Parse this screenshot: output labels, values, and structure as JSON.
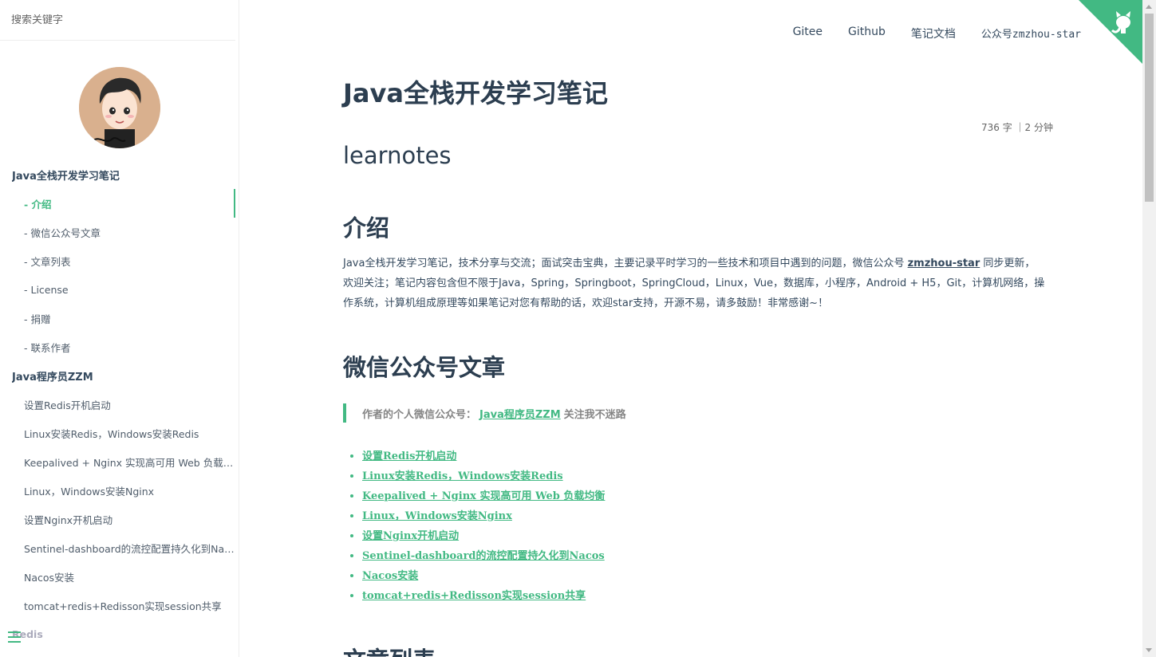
{
  "search": {
    "placeholder": "搜索关键字"
  },
  "sidebar": {
    "sections": [
      {
        "label": "Java全栈开发学习笔记"
      },
      {
        "label": "Java程序员ZZM"
      },
      {
        "label": "Redis"
      }
    ],
    "subitems": [
      "- 介绍",
      "- 微信公众号文章",
      "- 文章列表",
      "- License",
      "- 捐赠",
      "- 联系作者"
    ],
    "articles": [
      "设置Redis开机启动",
      "Linux安装Redis，Windows安装Redis",
      "Keepalived + Nginx 实现高可用 Web 负载均衡",
      "Linux，Windows安装Nginx",
      "设置Nginx开机启动",
      "Sentinel-dashboard的流控配置持久化到Nacos",
      "Nacos安装",
      "tomcat+redis+Redisson实现session共享"
    ]
  },
  "topnav": {
    "gitee": "Gitee",
    "github": "Github",
    "docs": "笔记文档",
    "wechat": "公众号zmzhou-star"
  },
  "content": {
    "title": "Java全栈开发学习笔记",
    "wordcount": "736 字 ｜2 分钟",
    "subtitle": "learnotes",
    "intro_heading": "介绍",
    "intro_text_1": "Java全栈开发学习笔记，技术分享与交流；面试突击宝典，主要记录平时学习的一些技术和项目中遇到的问题，微信公众号 ",
    "intro_link": "zmzhou-star",
    "intro_text_2": " 同步更新，欢迎关注；笔记内容包含但不限于Java，Spring，Springboot，SpringCloud，Linux，Vue，数据库，小程序，Android + H5，Git，计算机网络，操作系统，计算机组成原理等如果笔记对您有帮助的话，欢迎star支持，开源不易，请多鼓励！非常感谢~！",
    "wechat_heading": "微信公众号文章",
    "quote_prefix": "作者的个人微信公众号：",
    "quote_link": "Java程序员ZZM",
    "quote_suffix": "关注我不迷路",
    "article_links": [
      "设置Redis开机启动",
      "Linux安装Redis，Windows安装Redis",
      "Keepalived + Nginx 实现高可用 Web 负载均衡",
      "Linux，Windows安装Nginx",
      "设置Nginx开机启动",
      "Sentinel-dashboard的流控配置持久化到Nacos",
      "Nacos安装",
      "tomcat+redis+Redisson实现session共享"
    ],
    "list_heading": "文章列表"
  },
  "colors": {
    "accent": "#42b983",
    "text": "#34495e",
    "heading": "#2c3e50"
  },
  "icons": {
    "corner": "github-corner-icon",
    "menu": "menu-icon",
    "avatar": "avatar-image"
  }
}
